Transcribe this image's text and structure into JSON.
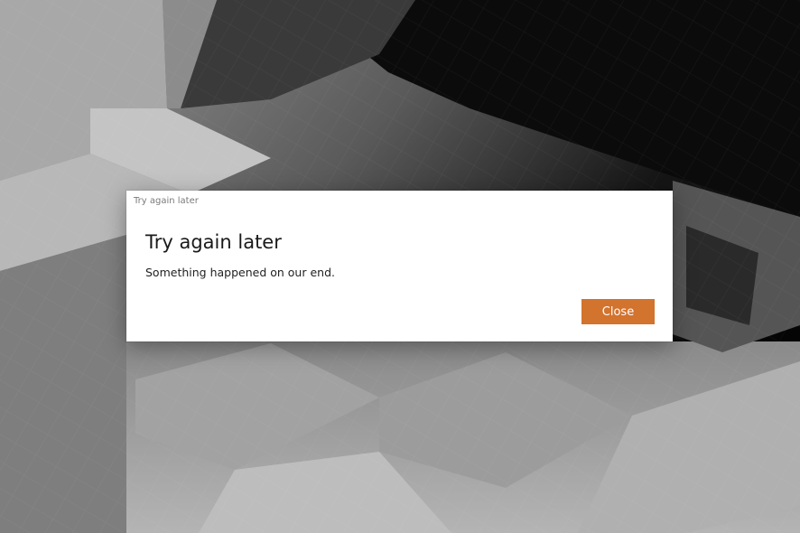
{
  "window": {
    "title": "Try again later"
  },
  "dialog": {
    "heading": "Try again later",
    "message": "Something happened on our end.",
    "close_label": "Close"
  },
  "colors": {
    "accent": "#d2732e",
    "dialog_background": "#ffffff",
    "wallpaper_dark": "#0a0a0a",
    "wallpaper_light": "#c8c8c8"
  }
}
